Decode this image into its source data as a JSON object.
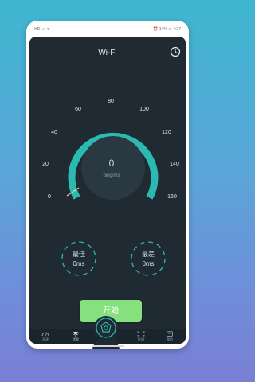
{
  "status_bar": {
    "left": "HD ..ıl ᯤ",
    "right": "⏰ 14% ▭ 4:27"
  },
  "header": {
    "title": "Wi-Fi",
    "history_icon": "clock-icon"
  },
  "gauge": {
    "ticks": [
      "0",
      "20",
      "40",
      "60",
      "80",
      "100",
      "120",
      "140",
      "160"
    ],
    "value": "0",
    "unit": "ping/ms",
    "accent_color": "#2bb9b2"
  },
  "metrics": {
    "best_label": "最佳",
    "best_value": "0ms",
    "worst_label": "最差",
    "worst_value": "0ms"
  },
  "start_button": {
    "label": "开始",
    "color": "#86e07e"
  },
  "tabbar": {
    "items": [
      {
        "label": "测速",
        "icon": "speed-icon"
      },
      {
        "label": "信号",
        "icon": "wifi-icon"
      },
      {
        "label": "",
        "icon": "center-target-icon"
      },
      {
        "label": "检测",
        "icon": "scan-icon"
      },
      {
        "label": "我的",
        "icon": "user-icon"
      }
    ]
  }
}
